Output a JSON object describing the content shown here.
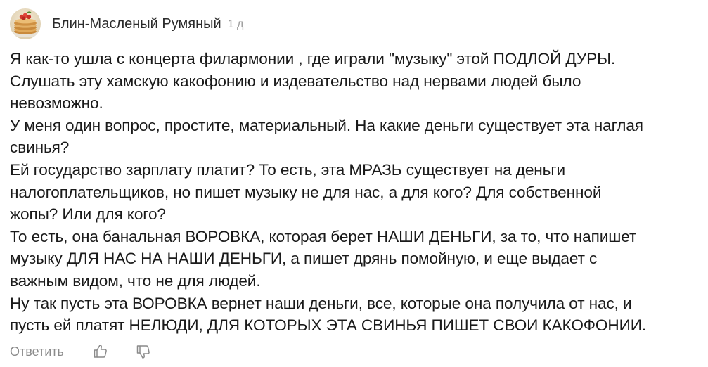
{
  "comment": {
    "author": "Блин-Масленый Румяный",
    "time": "1 д",
    "avatar_icon": "pancake-stack-avatar",
    "paragraphs": [
      "Я как-то ушла с концерта филармонии , где играли \"музыку\" этой ПОДЛОЙ ДУРЫ.\nСлушать эту хамскую какофонию и издевательство над нервами людей было\nневозможно.",
      "У меня один вопрос, простите, материальный. На какие деньги существует эта наглая\nсвинья?",
      "Ей государство зарплату платит? То есть, эта МРАЗЬ существует на деньги\nналогоплательщиков, но пишет музыку не для нас, а для кого? Для собственной\nжопы? Или для кого?",
      "То есть, она банальная ВОРОВКА, которая берет НАШИ ДЕНЬГИ, за то, что напишет\nмузыку ДЛЯ НАС НА НАШИ ДЕНЬГИ, а пишет дрянь помойную, и еще выдает с\nважным видом, что не для людей.",
      "Ну так пусть эта ВОРОВКА вернет наши деньги, все, которые она получила от нас, и\nпусть ей платят НЕЛЮДИ, ДЛЯ КОТОРЫХ ЭТА СВИНЬЯ ПИШЕТ СВОИ КАКОФОНИИ."
    ],
    "actions": {
      "reply_label": "Ответить",
      "like_icon": "thumbs-up-icon",
      "dislike_icon": "thumbs-down-icon"
    }
  },
  "colors": {
    "text": "#1a1a1a",
    "muted": "#9a9a9a",
    "icon": "#8a8a8a"
  }
}
